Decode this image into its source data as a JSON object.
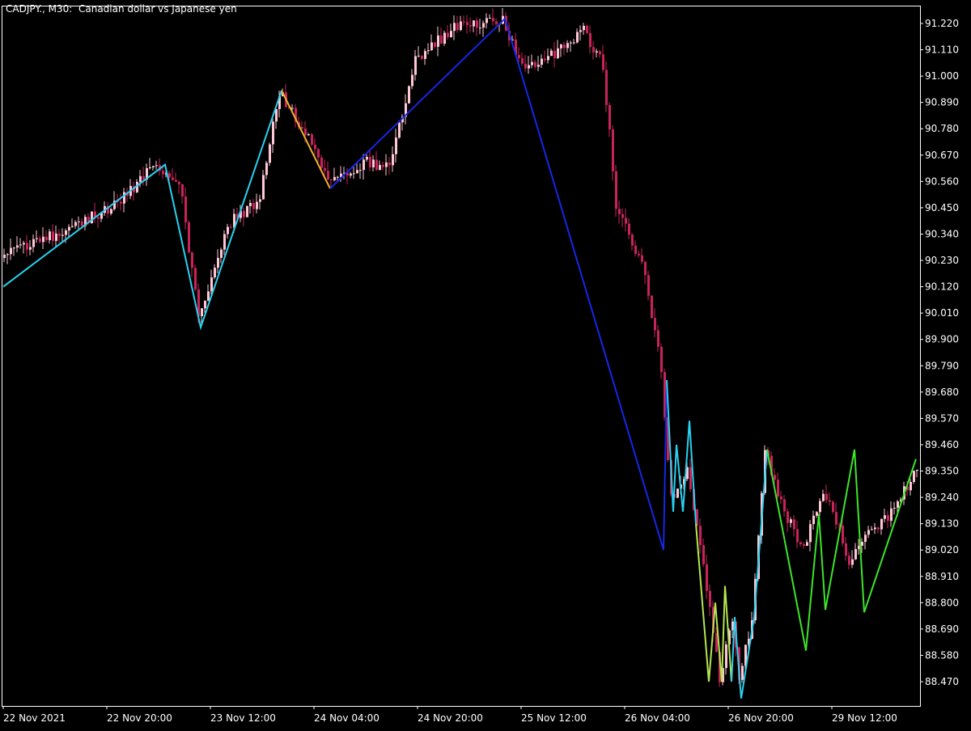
{
  "title": "CADJPY., M30:  Canadian dollar vs Japanese yen",
  "colors": {
    "background": "#000000",
    "axis": "#ffffff",
    "bull_candle": "#ffc8d6",
    "bear_candle": "#c8245a",
    "zigzag_cyan": "#28d2f0",
    "zigzag_blue": "#1428e6",
    "zigzag_orange": "#f0b428",
    "zigzag_green": "#3ce628",
    "zigzag_lime": "#b4e650"
  },
  "chart_data": {
    "type": "candlestick",
    "symbol": "CADJPY.",
    "timeframe": "M30",
    "description": "Canadian dollar vs Japanese yen",
    "y_ticks": [
      "91.220",
      "91.110",
      "91.000",
      "90.890",
      "90.780",
      "90.670",
      "90.560",
      "90.450",
      "90.340",
      "90.230",
      "90.120",
      "90.010",
      "89.900",
      "89.790",
      "89.680",
      "89.570",
      "89.460",
      "89.350",
      "89.240",
      "89.130",
      "89.020",
      "88.910",
      "88.800",
      "88.690",
      "88.580",
      "88.470"
    ],
    "y_tick_values": [
      91.22,
      91.11,
      91.0,
      90.89,
      90.78,
      90.67,
      90.56,
      90.45,
      90.34,
      90.23,
      90.12,
      90.01,
      89.9,
      89.79,
      89.68,
      89.57,
      89.46,
      89.35,
      89.24,
      89.13,
      89.02,
      88.91,
      88.8,
      88.69,
      88.58,
      88.47
    ],
    "ylim": [
      88.38,
      91.31
    ],
    "x_ticks": [
      "22 Nov 2021",
      "22 Nov 20:00",
      "23 Nov 12:00",
      "24 Nov 04:00",
      "24 Nov 20:00",
      "25 Nov 12:00",
      "26 Nov 04:00",
      "26 Nov 20:00",
      "29 Nov 12:00"
    ],
    "x_tick_bar_index": [
      0,
      32,
      64,
      96,
      128,
      160,
      192,
      224,
      256
    ],
    "bar_count": 283,
    "price_path": [
      [
        0,
        90.24
      ],
      [
        20,
        90.36
      ],
      [
        35,
        90.46
      ],
      [
        48,
        90.63
      ],
      [
        55,
        90.57
      ],
      [
        61,
        89.99
      ],
      [
        70,
        90.38
      ],
      [
        80,
        90.49
      ],
      [
        86,
        90.94
      ],
      [
        95,
        90.74
      ],
      [
        101,
        90.55
      ],
      [
        112,
        90.64
      ],
      [
        120,
        90.62
      ],
      [
        128,
        91.06
      ],
      [
        140,
        91.21
      ],
      [
        155,
        91.24
      ],
      [
        160,
        91.06
      ],
      [
        167,
        91.05
      ],
      [
        180,
        91.19
      ],
      [
        186,
        91.05
      ],
      [
        190,
        90.46
      ],
      [
        198,
        90.22
      ],
      [
        204,
        89.77
      ],
      [
        207,
        89.24
      ],
      [
        212,
        89.35
      ],
      [
        218,
        88.87
      ],
      [
        222,
        88.49
      ],
      [
        226,
        88.72
      ],
      [
        228,
        88.47
      ],
      [
        232,
        88.74
      ],
      [
        236,
        89.44
      ],
      [
        240,
        89.24
      ],
      [
        248,
        89.02
      ],
      [
        253,
        89.24
      ],
      [
        256,
        89.24
      ],
      [
        262,
        88.96
      ],
      [
        268,
        89.1
      ],
      [
        276,
        89.18
      ],
      [
        282,
        89.35
      ]
    ],
    "zigzag": [
      {
        "color": "zigzag_cyan",
        "points": [
          [
            0,
            90.12
          ],
          [
            50,
            90.63
          ],
          [
            61,
            89.95
          ],
          [
            86,
            90.94
          ]
        ]
      },
      {
        "color": "zigzag_orange",
        "points": [
          [
            86,
            90.94
          ],
          [
            101,
            90.53
          ]
        ]
      },
      {
        "color": "zigzag_blue",
        "points": [
          [
            101,
            90.53
          ],
          [
            155,
            91.24
          ],
          [
            204,
            89.02
          ],
          [
            205,
            89.73
          ]
        ]
      },
      {
        "color": "zigzag_cyan",
        "points": [
          [
            205,
            89.73
          ],
          [
            207,
            89.18
          ],
          [
            208,
            89.46
          ],
          [
            210,
            89.18
          ],
          [
            212,
            89.56
          ],
          [
            214,
            89.13
          ]
        ]
      },
      {
        "color": "zigzag_lime",
        "points": [
          [
            214,
            89.13
          ],
          [
            218,
            88.47
          ],
          [
            220,
            88.8
          ],
          [
            222,
            88.47
          ],
          [
            223,
            88.87
          ],
          [
            225,
            88.47
          ]
        ]
      },
      {
        "color": "zigzag_cyan",
        "points": [
          [
            225,
            88.47
          ],
          [
            226,
            88.74
          ],
          [
            228,
            88.4
          ],
          [
            232,
            88.74
          ],
          [
            236,
            89.44
          ]
        ]
      },
      {
        "color": "zigzag_green",
        "points": [
          [
            236,
            89.44
          ],
          [
            248,
            88.6
          ],
          [
            252,
            89.17
          ],
          [
            254,
            88.77
          ],
          [
            263,
            89.44
          ],
          [
            266,
            88.76
          ],
          [
            282,
            89.4
          ]
        ]
      }
    ]
  }
}
